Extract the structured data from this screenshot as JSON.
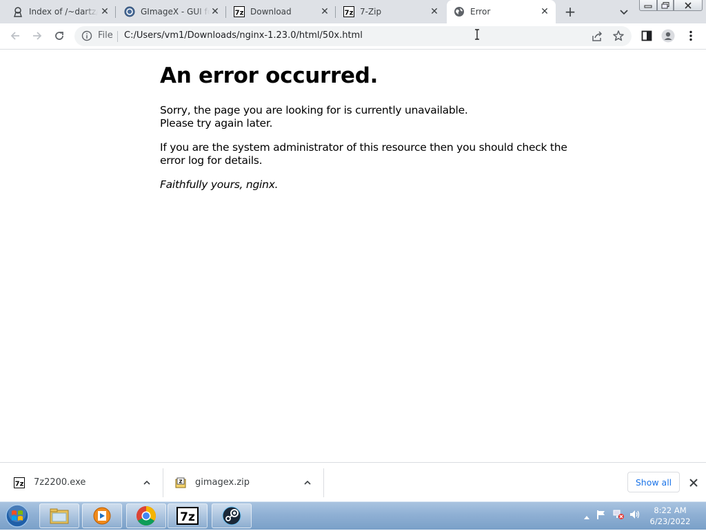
{
  "browser": {
    "tabs": [
      {
        "label": "Index of /~dartz/i",
        "icon": "page-icon"
      },
      {
        "label": "GImageX - GUI fo",
        "icon": "gimagex-icon"
      },
      {
        "label": "Download",
        "icon": "7z-icon"
      },
      {
        "label": "7-Zip",
        "icon": "7z-icon"
      },
      {
        "label": "Error",
        "icon": "globe-icon",
        "active": true
      }
    ],
    "omnibox": {
      "scheme_label": "File",
      "url": "C:/Users/vm1/Downloads/nginx-1.23.0/html/50x.html"
    }
  },
  "page": {
    "heading": "An error occurred.",
    "line1": "Sorry, the page you are looking for is currently unavailable.",
    "line2": "Please try again later.",
    "line3": "If you are the system administrator of this resource then you should check the",
    "line4": "error log for details.",
    "signature": "Faithfully yours, nginx."
  },
  "downloads": {
    "items": [
      {
        "name": "7z2200.exe"
      },
      {
        "name": "gimagex.zip"
      }
    ],
    "show_all_label": "Show all"
  },
  "taskbar": {
    "apps": [
      "explorer",
      "media-player",
      "chrome",
      "7-zip",
      "steam"
    ],
    "clock_time": "8:22 AM",
    "clock_date": "6/23/2022"
  },
  "colors": {
    "tabstrip": "#dee1e6",
    "omnibox": "#f1f3f4",
    "link_blue": "#1a73e8",
    "taskbar": "#8fb0d4"
  }
}
